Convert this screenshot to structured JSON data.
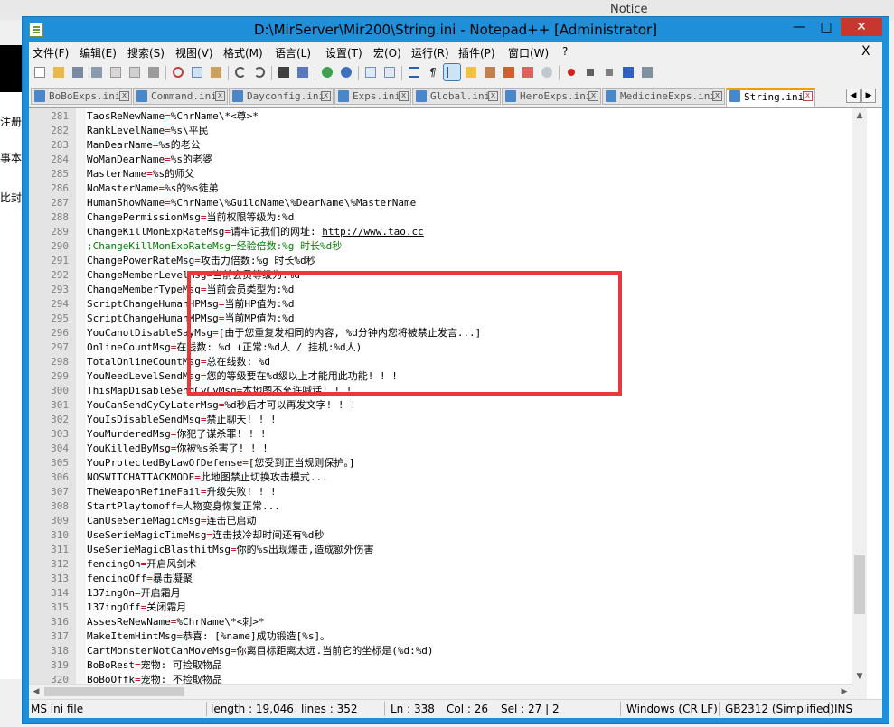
{
  "background": {
    "notice_text": "Notice",
    "left_fragments": [
      "注册",
      "事本",
      "比封"
    ]
  },
  "window": {
    "title": "D:\\MirServer\\Mir200\\String.ini - Notepad++ [Administrator]"
  },
  "menu": {
    "items": [
      "文件(F)",
      "编辑(E)",
      "搜索(S)",
      "视图(V)",
      "格式(M)",
      "语言(L)",
      "设置(T)",
      "宏(O)",
      "运行(R)",
      "插件(P)",
      "窗口(W)",
      "?"
    ],
    "close_glyph": "X"
  },
  "toolbar": {
    "icons": [
      "new-file",
      "open-file",
      "save",
      "save-all",
      "close",
      "close-all",
      "print",
      "cut",
      "copy",
      "paste",
      "undo",
      "redo",
      "find",
      "replace",
      "zoom-in",
      "zoom-out",
      "sync-vertical",
      "sync-horizontal",
      "word-wrap",
      "show-all-chars",
      "indent-guide",
      "define-language",
      "doc-map",
      "function-list",
      "folder-workspace",
      "monitor",
      "record-macro",
      "stop-record",
      "play-macro",
      "run-macro-multiple",
      "save-macro"
    ]
  },
  "tabs": {
    "items": [
      {
        "label": "BoBoExps.ini",
        "active": false
      },
      {
        "label": "Command.ini",
        "active": false
      },
      {
        "label": "Dayconfig.ini",
        "active": false
      },
      {
        "label": "Exps.ini",
        "active": false
      },
      {
        "label": "Global.ini",
        "active": false
      },
      {
        "label": "HeroExps.ini",
        "active": false
      },
      {
        "label": "MedicineExps.ini",
        "active": false
      },
      {
        "label": "String.ini",
        "active": true
      }
    ],
    "close_glyph": "x",
    "prev_glyph": "◀",
    "next_glyph": "▶"
  },
  "editor": {
    "lines": [
      {
        "n": "281",
        "key": "TaosReNewName",
        "value": "%ChrName\\*<尊>*"
      },
      {
        "n": "282",
        "key": "RankLevelName",
        "value": "%s\\平民"
      },
      {
        "n": "283",
        "key": "ManDearName",
        "value": "%s的老公"
      },
      {
        "n": "284",
        "key": "WoManDearName",
        "value": "%s的老婆"
      },
      {
        "n": "285",
        "key": "MasterName",
        "value": "%s的师父"
      },
      {
        "n": "286",
        "key": "NoMasterName",
        "value": "%s的%s徒弟"
      },
      {
        "n": "287",
        "key": "HumanShowName",
        "value": "%ChrName\\%GuildName\\%DearName\\%MasterName"
      },
      {
        "n": "288",
        "key": "ChangePermissionMsg",
        "value": "当前权限等级为:%d"
      },
      {
        "n": "289",
        "key": "ChangeKillMonExpRateMsg",
        "value": "请牢记我们的网址: ",
        "url": "http://www.tao.cc"
      },
      {
        "n": "290",
        "comment": ";ChangeKillMonExpRateMsg=经验倍数:%g 时长%d秒"
      },
      {
        "n": "291",
        "key": "ChangePowerRateMsg",
        "value": "攻击力倍数:%g 时长%d秒"
      },
      {
        "n": "292",
        "key": "ChangeMemberLevelMsg",
        "value": "当前会员等级为:%d"
      },
      {
        "n": "293",
        "key": "ChangeMemberTypeMsg",
        "value": "当前会员类型为:%d"
      },
      {
        "n": "294",
        "key": "ScriptChangeHumanHPMsg",
        "value": "当前HP值为:%d"
      },
      {
        "n": "295",
        "key": "ScriptChangeHumanMPMsg",
        "value": "当前MP值为:%d"
      },
      {
        "n": "296",
        "key": "YouCanotDisableSayMsg",
        "value": "[由于您重复发相同的内容, %d分钟内您将被禁止发言...]"
      },
      {
        "n": "297",
        "key": "OnlineCountMsg",
        "value": "在线数: %d (正常:%d人 / 挂机:%d人)"
      },
      {
        "n": "298",
        "key": "TotalOnlineCountMsg",
        "value": "总在线数: %d"
      },
      {
        "n": "299",
        "key": "YouNeedLevelSendMsg",
        "value": "您的等级要在%d级以上才能用此功能! ! !"
      },
      {
        "n": "300",
        "key": "ThisMapDisableSendCyCyMsg",
        "value": "本地图不允许喊话! ! !"
      },
      {
        "n": "301",
        "key": "YouCanSendCyCyLaterMsg",
        "value": "%d秒后才可以再发文字! ! !"
      },
      {
        "n": "302",
        "key": "YouIsDisableSendMsg",
        "value": "禁止聊天! ! !"
      },
      {
        "n": "303",
        "key": "YouMurderedMsg",
        "value": "你犯了谋杀罪! ! !"
      },
      {
        "n": "304",
        "key": "YouKilledByMsg",
        "value": "你被%s杀害了! ! !"
      },
      {
        "n": "305",
        "key": "YouProtectedByLawOfDefense",
        "value": "[您受到正当规则保护。]"
      },
      {
        "n": "306",
        "key": "NOSWITCHATTACKMODE",
        "value": "此地图禁止切换攻击模式..."
      },
      {
        "n": "307",
        "key": "TheWeaponRefineFail",
        "value": "升级失败! ! !"
      },
      {
        "n": "308",
        "key": "StartPlaytomoff",
        "value": "人物变身恢复正常..."
      },
      {
        "n": "309",
        "key": "CanUseSerieMagicMsg",
        "value": "连击已启动"
      },
      {
        "n": "310",
        "key": "UseSerieMagicTimeMsg",
        "value": "连击技冷却时间还有%d秒"
      },
      {
        "n": "311",
        "key": "UseSerieMagicBlasthitMsg",
        "value": "你的%s出现爆击,造成额外伤害"
      },
      {
        "n": "312",
        "key": "fencingOn",
        "value": "开启风剑术"
      },
      {
        "n": "313",
        "key": "fencingOff",
        "value": "暴击凝聚"
      },
      {
        "n": "314",
        "key": "137ingOn",
        "value": "开启霜月"
      },
      {
        "n": "315",
        "key": "137ingOff",
        "value": "关闭霜月"
      },
      {
        "n": "316",
        "key": "AssesReNewName",
        "value": "%ChrName\\*<刺>*"
      },
      {
        "n": "317",
        "key": "MakeItemHintMsg",
        "value": "恭喜: [%name]成功锻造[%s]。"
      },
      {
        "n": "318",
        "key": "CartMonsterNotCanMoveMsg",
        "value": "你离目标距离太远.当前它的坐标是(%d:%d)"
      },
      {
        "n": "319",
        "key": "BoBoRest",
        "value": "宠物: 可捡取物品"
      },
      {
        "n": "320",
        "key": "BoBoOffk",
        "value": "宠物: 不捡取物品"
      }
    ]
  },
  "scroll": {
    "up": "▲",
    "down": "▼",
    "left": "◀",
    "right": "▶"
  },
  "status": {
    "file_type": "MS ini file",
    "length": "length : 19,046",
    "lines": "lines : 352",
    "ln": "Ln : 338",
    "col": "Col : 26",
    "sel": "Sel : 27 | 2",
    "eol": "Windows (CR LF)",
    "encoding": "GB2312 (Simplified)",
    "mode": "INS"
  },
  "colors": {
    "title_bar": "#1e8fd8",
    "highlight": "#e8383c",
    "key_separator": "#c00000",
    "comment": "#008000"
  }
}
